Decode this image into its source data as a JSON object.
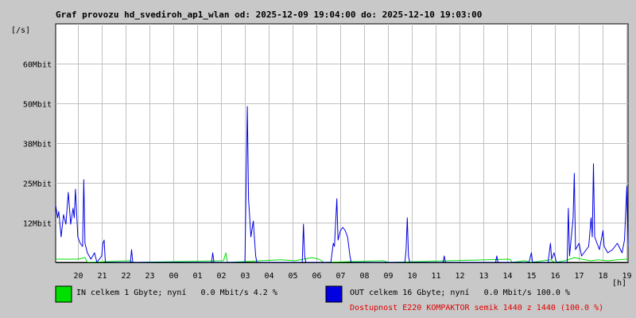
{
  "chart_data": {
    "type": "line",
    "title": "Graf provozu hd_svediroh_ap1_wlan od: 2025-12-09 19:04:00 do: 2025-12-10 19:03:00",
    "ylabel": "[/s]",
    "xlabel": "[h]",
    "x_ticks": [
      "20",
      "21",
      "22",
      "23",
      "00",
      "01",
      "02",
      "03",
      "04",
      "05",
      "06",
      "07",
      "08",
      "09",
      "10",
      "11",
      "12",
      "13",
      "14",
      "15",
      "16",
      "17",
      "18",
      "19"
    ],
    "y_ticks": [
      {
        "label": "12Mbit",
        "value": 12.5
      },
      {
        "label": "25Mbit",
        "value": 25
      },
      {
        "label": "38Mbit",
        "value": 37.5
      },
      {
        "label": "50Mbit",
        "value": 50
      },
      {
        "label": "60Mbit",
        "value": 62.5
      }
    ],
    "ylim": [
      0,
      75
    ],
    "xlim": [
      19.07,
      43.05
    ],
    "grid": true,
    "series": [
      {
        "name": "IN",
        "color": "#00e000",
        "points": [
          [
            19.07,
            1
          ],
          [
            19.5,
            1
          ],
          [
            20.0,
            1
          ],
          [
            20.3,
            1.5
          ],
          [
            20.4,
            0
          ],
          [
            22.2,
            0.5
          ],
          [
            22.3,
            0
          ],
          [
            26.1,
            0.5
          ],
          [
            26.2,
            3
          ],
          [
            26.25,
            0.5
          ],
          [
            26.3,
            0
          ],
          [
            28.5,
            0.8
          ],
          [
            29.1,
            0.5
          ],
          [
            29.8,
            1.5
          ],
          [
            30.1,
            1
          ],
          [
            30.3,
            0
          ],
          [
            32.8,
            0.5
          ],
          [
            33.0,
            0
          ],
          [
            38.1,
            1
          ],
          [
            38.2,
            0
          ],
          [
            38.7,
            0.5
          ],
          [
            39.0,
            0
          ],
          [
            39.8,
            0.8
          ],
          [
            40.0,
            0
          ],
          [
            40.4,
            0.5
          ],
          [
            40.8,
            1.5
          ],
          [
            41.1,
            1
          ],
          [
            41.5,
            0.5
          ],
          [
            41.8,
            0.8
          ],
          [
            42.2,
            0.5
          ],
          [
            42.6,
            0.8
          ],
          [
            43.0,
            1
          ],
          [
            43.05,
            1
          ]
        ]
      },
      {
        "name": "OUT",
        "color": "#0000e0",
        "points": [
          [
            19.07,
            18
          ],
          [
            19.15,
            14
          ],
          [
            19.2,
            16
          ],
          [
            19.3,
            8
          ],
          [
            19.4,
            15
          ],
          [
            19.5,
            12
          ],
          [
            19.6,
            22
          ],
          [
            19.7,
            12
          ],
          [
            19.8,
            17
          ],
          [
            19.85,
            14
          ],
          [
            19.9,
            23
          ],
          [
            20.0,
            8
          ],
          [
            20.1,
            6
          ],
          [
            20.2,
            5
          ],
          [
            20.25,
            26
          ],
          [
            20.3,
            6
          ],
          [
            20.4,
            3
          ],
          [
            20.55,
            1
          ],
          [
            20.7,
            3
          ],
          [
            20.8,
            0
          ],
          [
            21.0,
            2
          ],
          [
            21.05,
            6
          ],
          [
            21.1,
            7
          ],
          [
            21.15,
            0
          ],
          [
            22.2,
            0
          ],
          [
            22.25,
            4
          ],
          [
            22.3,
            0
          ],
          [
            25.6,
            0
          ],
          [
            25.65,
            3
          ],
          [
            25.7,
            0
          ],
          [
            27.0,
            0
          ],
          [
            27.05,
            25
          ],
          [
            27.1,
            49
          ],
          [
            27.15,
            20
          ],
          [
            27.25,
            8
          ],
          [
            27.35,
            13
          ],
          [
            27.45,
            2
          ],
          [
            27.5,
            0
          ],
          [
            29.4,
            0
          ],
          [
            29.45,
            12
          ],
          [
            29.5,
            2
          ],
          [
            29.55,
            0
          ],
          [
            30.6,
            0
          ],
          [
            30.7,
            6
          ],
          [
            30.75,
            5
          ],
          [
            30.85,
            20
          ],
          [
            30.9,
            7
          ],
          [
            31.0,
            10
          ],
          [
            31.1,
            11
          ],
          [
            31.2,
            10
          ],
          [
            31.3,
            8
          ],
          [
            31.4,
            2
          ],
          [
            31.45,
            0
          ],
          [
            33.7,
            0
          ],
          [
            33.75,
            4
          ],
          [
            33.8,
            14
          ],
          [
            33.85,
            2
          ],
          [
            33.9,
            0
          ],
          [
            35.3,
            0
          ],
          [
            35.35,
            2
          ],
          [
            35.4,
            0
          ],
          [
            37.5,
            0
          ],
          [
            37.55,
            2
          ],
          [
            37.6,
            0
          ],
          [
            38.9,
            0
          ],
          [
            39.0,
            3
          ],
          [
            39.05,
            0
          ],
          [
            39.7,
            0
          ],
          [
            39.8,
            6
          ],
          [
            39.85,
            1
          ],
          [
            39.95,
            3
          ],
          [
            40.05,
            0
          ],
          [
            40.5,
            0
          ],
          [
            40.55,
            17
          ],
          [
            40.6,
            2
          ],
          [
            40.75,
            14
          ],
          [
            40.8,
            28
          ],
          [
            40.85,
            4
          ],
          [
            41.0,
            6
          ],
          [
            41.1,
            2
          ],
          [
            41.3,
            4
          ],
          [
            41.4,
            5
          ],
          [
            41.5,
            14
          ],
          [
            41.55,
            8
          ],
          [
            41.6,
            31
          ],
          [
            41.65,
            8
          ],
          [
            41.75,
            6
          ],
          [
            41.85,
            4
          ],
          [
            42.0,
            10
          ],
          [
            42.05,
            5
          ],
          [
            42.2,
            3
          ],
          [
            42.4,
            4
          ],
          [
            42.6,
            6
          ],
          [
            42.8,
            3
          ],
          [
            42.9,
            7
          ],
          [
            43.0,
            24
          ],
          [
            43.05,
            5
          ]
        ]
      }
    ],
    "legend": [
      {
        "label": "IN celkem 1 Gbyte; nyní   0.0 Mbit/s 4.2 %",
        "color": "#00e000"
      },
      {
        "label": "OUT celkem 16 Gbyte; nyní   0.0 Mbit/s 100.0 %",
        "color": "#0000e0"
      }
    ],
    "footer": "Dostupnost E220 KOMPAKTOR semik 1440 z 1440 (100.0 %)"
  }
}
